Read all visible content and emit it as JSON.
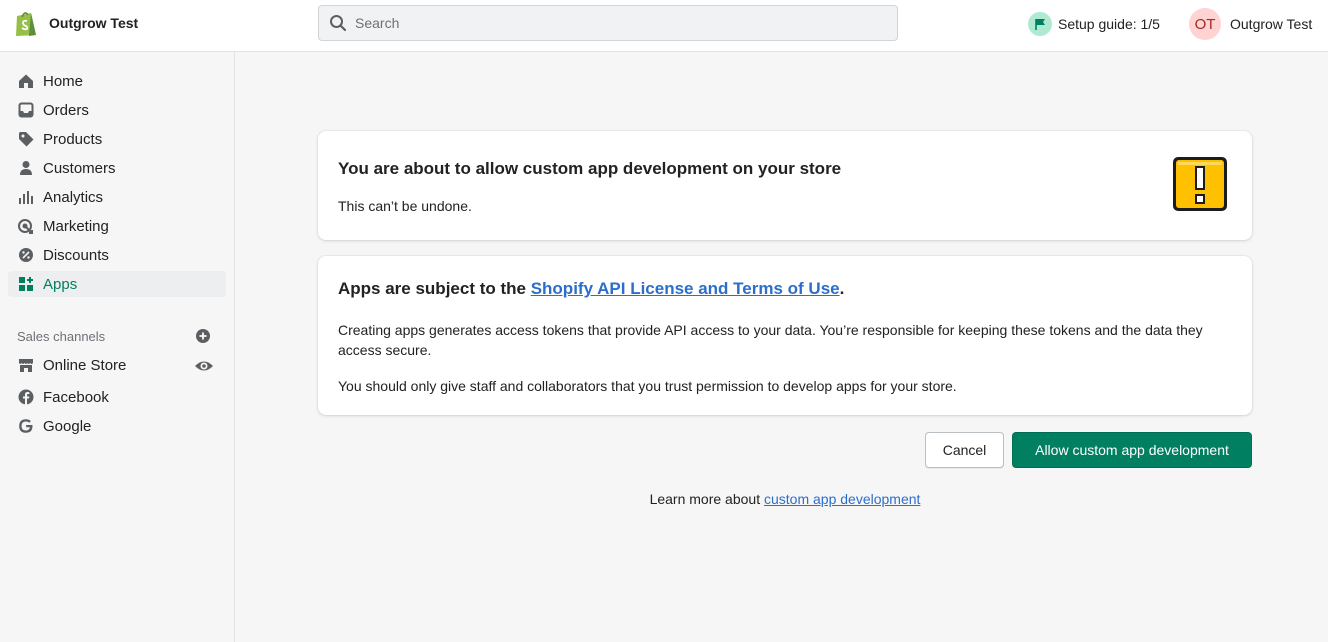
{
  "header": {
    "store_name": "Outgrow Test",
    "search_placeholder": "Search",
    "setup_guide": "Setup guide: 1/5",
    "avatar_initials": "OT",
    "user_name": "Outgrow Test"
  },
  "sidebar": {
    "items": [
      {
        "label": "Home",
        "icon": "home-icon"
      },
      {
        "label": "Orders",
        "icon": "orders-icon"
      },
      {
        "label": "Products",
        "icon": "tag-icon"
      },
      {
        "label": "Customers",
        "icon": "person-icon"
      },
      {
        "label": "Analytics",
        "icon": "bar-chart-icon"
      },
      {
        "label": "Marketing",
        "icon": "target-icon"
      },
      {
        "label": "Discounts",
        "icon": "discount-icon"
      },
      {
        "label": "Apps",
        "icon": "apps-icon",
        "active": true
      }
    ],
    "sales_channels_title": "Sales channels",
    "channels": [
      {
        "label": "Online Store",
        "icon": "store-icon"
      },
      {
        "label": "Facebook",
        "icon": "facebook-icon"
      },
      {
        "label": "Google",
        "icon": "google-icon"
      }
    ]
  },
  "main": {
    "card1": {
      "title": "You are about to allow custom app development on your store",
      "body": "This can’t be undone."
    },
    "card2": {
      "title_prefix": "Apps are subject to the ",
      "title_link": "Shopify API License and Terms of Use",
      "title_suffix": ".",
      "para1": "Creating apps generates access tokens that provide API access to your data. You’re responsible for keeping these tokens and the data they access secure.",
      "para2": "You should only give staff and collaborators that you trust permission to develop apps for your store."
    },
    "cancel_label": "Cancel",
    "allow_label": "Allow custom app development",
    "learn_prefix": "Learn more about ",
    "learn_link": "custom app development"
  },
  "colors": {
    "primary": "#008060",
    "active_nav": "#007f5f",
    "link": "#2c6ecb",
    "warning": "#ffc000"
  }
}
